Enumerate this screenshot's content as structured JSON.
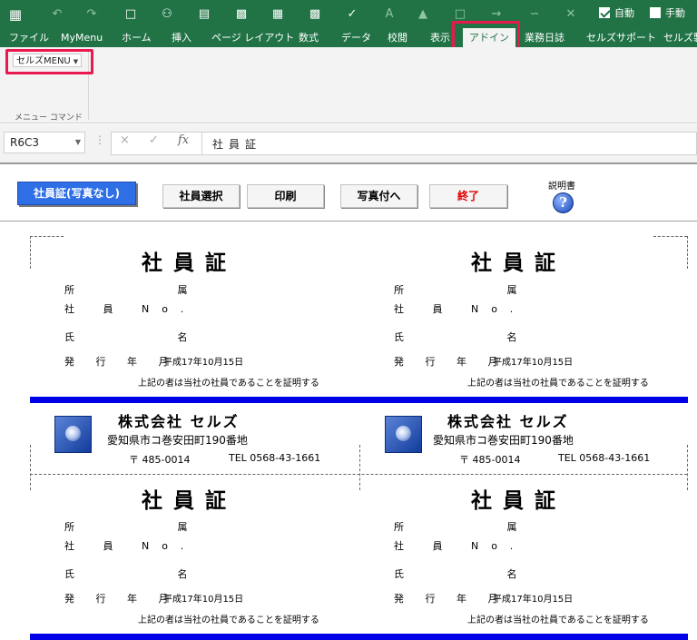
{
  "quick_access": {
    "save_icon": "save-icon",
    "undo_icon": "undo-icon",
    "redo_icon": "redo-icon",
    "new_icon": "new-file-icon",
    "print_preview_icon": "print-preview-icon",
    "open_icon": "open-folder-icon",
    "camera_icon": "camera-icon",
    "checks": [
      {
        "label": "自動",
        "checked": true
      },
      {
        "label": "手動",
        "checked": false
      }
    ]
  },
  "tabs": [
    "ファイル",
    "MyMenu",
    "ホーム",
    "挿入",
    "ページ レイアウト",
    "数式",
    "データ",
    "校閲",
    "表示",
    "アドイン",
    "業務日誌",
    "セルズサポート",
    "セルズ製"
  ],
  "active_tab": "アドイン",
  "ribbon": {
    "menu_button": "セルズMENU",
    "group_label": "メニュー コマンド"
  },
  "formula_bar": {
    "name_box": "R6C3",
    "cancel": "×",
    "enter": "✓",
    "fx": "fx",
    "value": "社員証"
  },
  "sheet_buttons": {
    "photo_none": "社員証(写真なし)",
    "select_employee": "社員選択",
    "print": "印刷",
    "with_photo": "写真付へ",
    "exit": "終了",
    "manual": "説明書",
    "help_glyph": "?"
  },
  "card": {
    "title": "社員証",
    "dept_label": "所 属",
    "employee_no_label": "社 員 No.",
    "name_label": "氏 名",
    "issue_date_label": "発 行 年 月",
    "issue_date": "平成17年10月15日",
    "certify_text": "上記の者は当社の社員であることを証明する",
    "company": "株式会社 セルズ",
    "address": "愛知県市コ巻安田町190番地",
    "postal": "〒 485-0014",
    "tel": "TEL 0568-43-1661"
  },
  "colors": {
    "excel_green": "#217346",
    "highlight": "#e8194e",
    "band_blue": "#0000e6",
    "button_blue": "#2f6fe6",
    "exit_red": "#e00000"
  }
}
